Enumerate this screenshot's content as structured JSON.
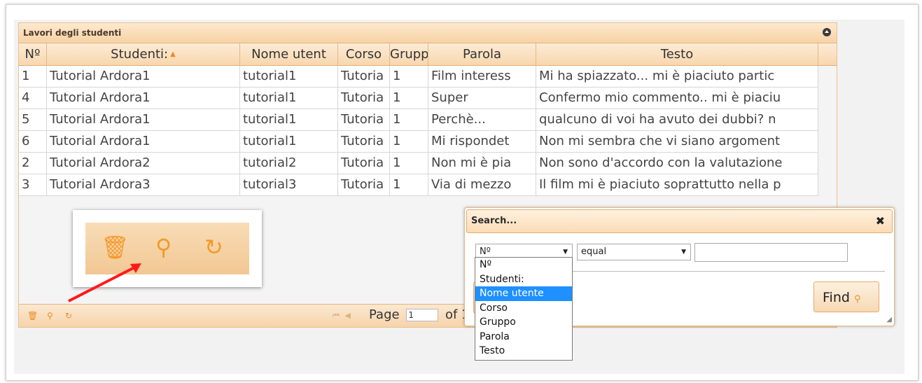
{
  "grid": {
    "title": "Lavori degli studenti",
    "columns": [
      "Nº",
      "Studenti:",
      "Nome utent",
      "Corso",
      "Grupp",
      "Parola",
      "Testo"
    ],
    "rows": [
      [
        "1",
        "Tutorial Ardora1",
        "tutorial1",
        "Tutoria",
        "1",
        "Film interess",
        "Mi ha spiazzato... mi è piaciuto partic"
      ],
      [
        "4",
        "Tutorial Ardora1",
        "tutorial1",
        "Tutoria",
        "1",
        "Super",
        "Confermo mio commento.. mi è piaciu"
      ],
      [
        "5",
        "Tutorial Ardora1",
        "tutorial1",
        "Tutoria",
        "1",
        "Perchè...",
        "qualcuno di voi ha avuto dei dubbi? n"
      ],
      [
        "6",
        "Tutorial Ardora1",
        "tutorial1",
        "Tutoria",
        "1",
        "Mi rispondet",
        "Non mi sembra che vi siano argoment"
      ],
      [
        "2",
        "Tutorial Ardora2",
        "tutorial2",
        "Tutoria",
        "1",
        "Non mi è pia",
        "Non sono d'accordo con la valutazione"
      ],
      [
        "3",
        "Tutorial Ardora3",
        "tutorial3",
        "Tutoria",
        "1",
        "Via di mezzo",
        "Il film mi è piaciuto soprattutto nella p"
      ]
    ],
    "pager": {
      "page_label": "Page",
      "page_value": "1",
      "of_label": "of 1"
    }
  },
  "search": {
    "title": "Search...",
    "field_select": "Nº",
    "operator_select": "equal",
    "value": "",
    "find_label": "Find",
    "options": [
      "Nº",
      "Studenti:",
      "Nome utente",
      "Corso",
      "Gruppo",
      "Parola",
      "Testo"
    ],
    "highlighted_option": "Nome utente"
  },
  "colors": {
    "accent": "#f39a2a",
    "header": "#f8d7ae",
    "selection": "#1e90ff"
  },
  "icons": [
    "collapse-icon",
    "trash-icon",
    "search-icon",
    "refresh-icon",
    "close-icon",
    "caret-down-icon"
  ]
}
